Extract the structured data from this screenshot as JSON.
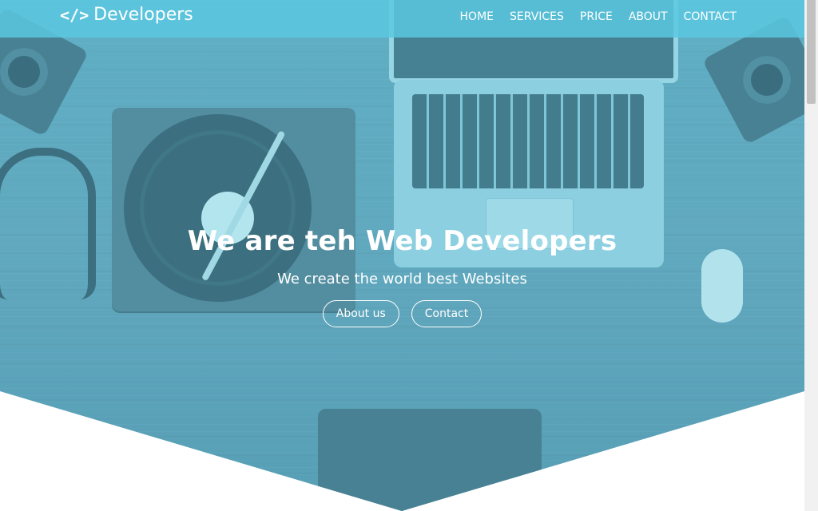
{
  "header": {
    "brand": {
      "icon": "</>",
      "name": "Developers"
    },
    "nav": [
      {
        "label": "HOME"
      },
      {
        "label": "SERVICES"
      },
      {
        "label": "PRICE"
      },
      {
        "label": "ABOUT"
      },
      {
        "label": "CONTACT"
      }
    ]
  },
  "hero": {
    "title": "We are teh Web Developers",
    "subtitle": "We create the world best Websites",
    "buttons": [
      {
        "label": "About us"
      },
      {
        "label": "Contact"
      }
    ]
  },
  "colors": {
    "header_bg": "#5ac8e1",
    "hero_overlay": "#5aa7be",
    "text": "#ffffff",
    "scrollbar_track": "#f1f1f1",
    "scrollbar_thumb": "#c1c1c1"
  }
}
